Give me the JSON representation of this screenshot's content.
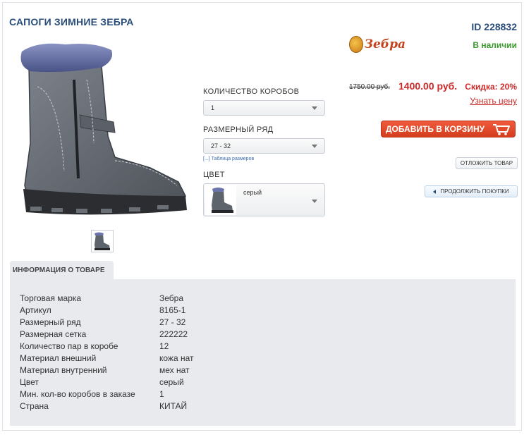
{
  "product": {
    "title": "САПОГИ ЗИМНИЕ ЗЕБРА",
    "id_text": "ID 228832",
    "brand_logo": "Зебра",
    "stock_status": "В наличии"
  },
  "price": {
    "old": "1750.00 руб.",
    "new": "1400.00 руб.",
    "discount": "Скидка: 20%",
    "ask_link": "Узнать цену"
  },
  "options": {
    "boxes_label": "КОЛИЧЕСТВО КОРОБОВ",
    "boxes_value": "1",
    "size_label": "РАЗМЕРНЫЙ РЯД",
    "size_value": "27 - 32",
    "size_table_link": "[...] Таблица размеров",
    "color_label": "ЦВЕТ",
    "color_value": "серый"
  },
  "actions": {
    "add_to_cart": "ДОБАВИТЬ В КОРЗИНУ",
    "defer": "ОТЛОЖИТЬ ТОВАР",
    "continue": "ПРОДОЛЖИТЬ ПОКУПКИ"
  },
  "info": {
    "tab_label": "ИНФОРМАЦИЯ О ТОВАРЕ",
    "rows": [
      {
        "k": "Торговая марка",
        "v": "Зебра"
      },
      {
        "k": "Артикул",
        "v": "8165-1"
      },
      {
        "k": "Размерный ряд",
        "v": "27 - 32"
      },
      {
        "k": "Размерная сетка",
        "v": "222222"
      },
      {
        "k": "Количество пар в коробе",
        "v": "12"
      },
      {
        "k": "Материал внешний",
        "v": "кожа нат"
      },
      {
        "k": "Материал внутренний",
        "v": "мех нат"
      },
      {
        "k": "Цвет",
        "v": "серый"
      },
      {
        "k": "Мин. кол-во коробов в заказе",
        "v": "1"
      },
      {
        "k": "Страна",
        "v": "КИТАЙ"
      }
    ]
  },
  "icons": {
    "cart": "cart-icon",
    "back_arrow": "arrow-left-icon",
    "dropdown": "chevron-down-icon"
  },
  "colors": {
    "title": "#2a4d7a",
    "price_red": "#cc2a2a",
    "stock_green": "#3a9a2e",
    "cart_button": "#e04a2b",
    "panel_bg": "#e8eaed"
  }
}
